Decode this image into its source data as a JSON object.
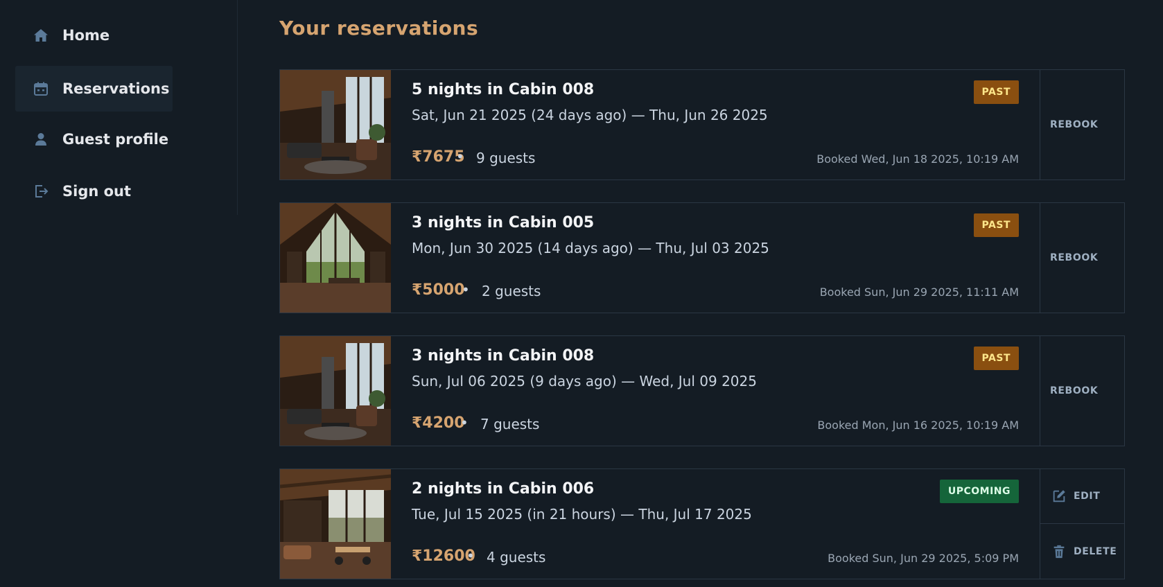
{
  "sidebar": {
    "items": [
      {
        "label": "Home",
        "icon": "home-icon",
        "active": false
      },
      {
        "label": "Reservations",
        "icon": "calendar-icon",
        "active": true
      },
      {
        "label": "Guest profile",
        "icon": "user-icon",
        "active": false
      },
      {
        "label": "Sign out",
        "icon": "sign-out-icon",
        "active": false
      }
    ]
  },
  "page": {
    "title": "Your reservations"
  },
  "colors": {
    "accent": "#d6a470",
    "past_badge": "#8a4f10",
    "upcoming_badge": "#15653a",
    "background": "#141c24"
  },
  "reservations": [
    {
      "title": "5 nights in Cabin 008",
      "dates": "Sat, Jun 21 2025 (24 days ago) — Thu, Jun 26 2025",
      "price": "₹7675",
      "separator": "•",
      "guests": "9 guests",
      "booked": "Booked Wed, Jun 18 2025, 10:19 AM",
      "status": "PAST",
      "actions": [
        "REBOOK"
      ]
    },
    {
      "title": "3 nights in Cabin 005",
      "dates": "Mon, Jun 30 2025 (14 days ago) — Thu, Jul 03 2025",
      "price": "₹5000",
      "separator": "•",
      "guests": "2 guests",
      "booked": "Booked Sun, Jun 29 2025, 11:11 AM",
      "status": "PAST",
      "actions": [
        "REBOOK"
      ]
    },
    {
      "title": "3 nights in Cabin 008",
      "dates": "Sun, Jul 06 2025 (9 days ago) — Wed, Jul 09 2025",
      "price": "₹4200",
      "separator": "•",
      "guests": "7 guests",
      "booked": "Booked Mon, Jun 16 2025, 10:19 AM",
      "status": "PAST",
      "actions": [
        "REBOOK"
      ]
    },
    {
      "title": "2 nights in Cabin 006",
      "dates": "Tue, Jul 15 2025 (in 21 hours) — Thu, Jul 17 2025",
      "price": "₹12600",
      "separator": "•",
      "guests": "4 guests",
      "booked": "Booked Sun, Jun 29 2025, 5:09 PM",
      "status": "UPCOMING",
      "actions": [
        "EDIT",
        "DELETE"
      ]
    }
  ]
}
